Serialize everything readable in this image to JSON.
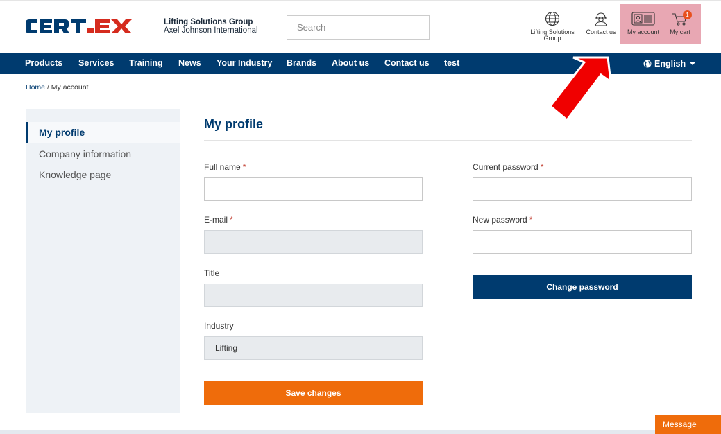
{
  "brand": {
    "logo_text": "CERTEX",
    "line1": "Lifting Solutions Group",
    "line2": "Axel Johnson International"
  },
  "search": {
    "placeholder": "Search"
  },
  "header_icons": [
    {
      "label": "Lifting Solutions Group",
      "icon": "globe-icon"
    },
    {
      "label": "Contact us",
      "icon": "support-agent-icon"
    },
    {
      "label": "My account",
      "icon": "id-card-icon"
    },
    {
      "label": "My cart",
      "icon": "cart-icon",
      "badge": "1"
    }
  ],
  "nav": {
    "items": [
      "Products",
      "Services",
      "Training",
      "News",
      "Your Industry",
      "Brands",
      "About us",
      "Contact us",
      "test"
    ],
    "language": "English"
  },
  "breadcrumb": {
    "home": "Home",
    "separator": "/",
    "current": "My account"
  },
  "sidebar": {
    "items": [
      {
        "label": "My profile",
        "active": true
      },
      {
        "label": "Company information",
        "active": false
      },
      {
        "label": "Knowledge page",
        "active": false
      }
    ]
  },
  "profile": {
    "title": "My profile",
    "required_mark": "*",
    "fields": {
      "full_name": {
        "label": "Full name",
        "value": ""
      },
      "email": {
        "label": "E-mail",
        "value": ""
      },
      "title": {
        "label": "Title",
        "value": ""
      },
      "industry": {
        "label": "Industry",
        "value": "Lifting"
      },
      "current_password": {
        "label": "Current password",
        "value": ""
      },
      "new_password": {
        "label": "New password",
        "value": ""
      }
    },
    "save_label": "Save changes",
    "change_password_label": "Change password"
  },
  "message_button": "Message",
  "colors": {
    "brand_blue": "#003b6f",
    "accent_orange": "#ef6c0b",
    "highlight_pink": "#e8a7b3",
    "arrow_red": "#f00000"
  }
}
